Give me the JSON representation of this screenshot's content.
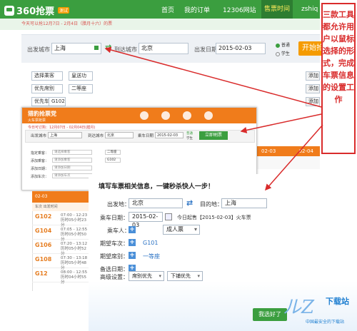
{
  "brand": {
    "name": "360抢票",
    "badge": "测试"
  },
  "nav": {
    "items": [
      "首页",
      "我的订单",
      "12306网站",
      "售票时间",
      "zshiq"
    ]
  },
  "notice": "今天可以抢12月7日 - 2月4日（腊月十六）的票",
  "search": {
    "from_label": "出发城市",
    "from_value": "上海",
    "to_label": "到达城市",
    "to_value": "北京",
    "date_label": "出发日期",
    "date_value": "2015-02-03",
    "type_normal": "普通",
    "type_student": "学生",
    "button": "开始抢"
  },
  "filters": {
    "passenger_label": "选择乘客",
    "passenger_chip": "皇送功",
    "seat_label": "优先席别",
    "seat_chip": "二等座",
    "train_label": "优先车次",
    "train_chip": "G102",
    "add": "添加"
  },
  "results": {
    "date1": "02-03",
    "date2": "02-04"
  },
  "shot2": {
    "logo": "猎豹抢票党",
    "logo_sub": "火车票抢票",
    "tip": "今日可订购：12月07日 - 02月04日(腊月)",
    "from_label": "出发城市",
    "from_value": "上海",
    "to_label": "到达城市",
    "to_value": "北京",
    "date_label": "乘车日期",
    "date_value": "2015-02-03",
    "normal": "普通",
    "student": "学生",
    "query_button": "立即刷票",
    "rows": [
      {
        "label": "指定乘客：",
        "ph": "请选择乘客",
        "chip": "二等座"
      },
      {
        "label": "添加乘客：",
        "ph": "请添加乘客",
        "chip": "G102"
      },
      {
        "label": "添加日期：",
        "ph": "请添加日期",
        "chip": ""
      },
      {
        "label": "添加车次：",
        "ph": "请添加车次",
        "chip": ""
      }
    ]
  },
  "trains": {
    "header": "02-03",
    "sub": "车次  出发时间",
    "list": [
      {
        "num": "G102",
        "time": "07:00 - 12:23",
        "dur": "历时05小时23分"
      },
      {
        "num": "G104",
        "time": "07:05 - 12:55",
        "dur": "历时05小时50分"
      },
      {
        "num": "G106",
        "time": "07:20 - 13:12",
        "dur": "历时05小时52分"
      },
      {
        "num": "G108",
        "time": "07:30 - 13:18",
        "dur": "历时05小时48分"
      },
      {
        "num": "G12",
        "time": "08:00 - 12:55",
        "dur": "历时04小时55分"
      }
    ]
  },
  "form": {
    "title": "填写车票相关信息，一键秒杀快人一步！",
    "from_label": "出发地：",
    "from_value": "北京",
    "to_label": "目的地：",
    "to_value": "上海",
    "date_label": "乘车日期：",
    "date_value": "2015-02-03",
    "date_note": "今日起售【2015-02-03】火车票",
    "passenger_label": "乘车人：",
    "passenger_ticket": "成人票",
    "train_label": "期望车次：",
    "train_value": "G101",
    "seat_label": "期望席别：",
    "seat_value": "一等座",
    "backup_label": "备选日期：",
    "advanced_label": "高级设置：",
    "advanced_opt1": "席别优先",
    "advanced_opt2": "下铺优先",
    "ok_button": "我选好了"
  },
  "callout": "三款工具都允许用户以鼠标选择的形式，完成车票信息的设置工作",
  "watermark": {
    "brand": "下载站",
    "sub": "中国最安全的下载站"
  }
}
